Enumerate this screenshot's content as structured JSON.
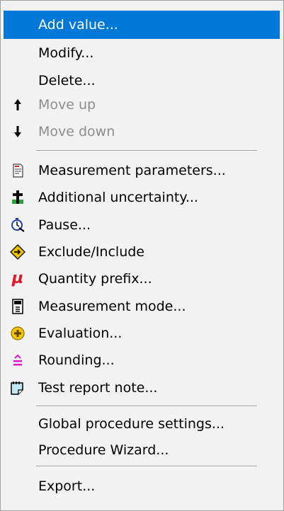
{
  "menu": {
    "items": [
      {
        "label": "Add value...",
        "state": "selected"
      },
      {
        "label": "Modify...",
        "state": "normal"
      },
      {
        "label": "Delete...",
        "state": "normal"
      },
      {
        "label": "Move up",
        "state": "disabled",
        "icon": "arrow-up-icon"
      },
      {
        "label": "Move down",
        "state": "disabled",
        "icon": "arrow-down-icon"
      },
      {
        "label": "Measurement parameters...",
        "state": "normal",
        "icon": "document-icon"
      },
      {
        "label": "Additional uncertainty...",
        "state": "normal",
        "icon": "plus-minus-icon"
      },
      {
        "label": "Pause...",
        "state": "normal",
        "icon": "stopwatch-icon"
      },
      {
        "label": "Exclude/Include",
        "state": "normal",
        "icon": "diamond-icon"
      },
      {
        "label": "Quantity prefix...",
        "state": "normal",
        "icon": "mu-icon"
      },
      {
        "label": "Measurement mode...",
        "state": "normal",
        "icon": "meter-icon"
      },
      {
        "label": "Evaluation...",
        "state": "normal",
        "icon": "evaluation-circle-icon"
      },
      {
        "label": "Rounding...",
        "state": "normal",
        "icon": "rounding-icon"
      },
      {
        "label": "Test report note...",
        "state": "normal",
        "icon": "note-icon"
      },
      {
        "label": "Global procedure settings...",
        "state": "normal"
      },
      {
        "label": "Procedure Wizard...",
        "state": "normal"
      },
      {
        "label": "Export...",
        "state": "normal"
      }
    ]
  },
  "colors": {
    "menu_background": "#f2f2f2",
    "selection": "#0078d7",
    "disabled_text": "#8d8d8d"
  },
  "icons": {
    "mu_glyph": "µ"
  }
}
